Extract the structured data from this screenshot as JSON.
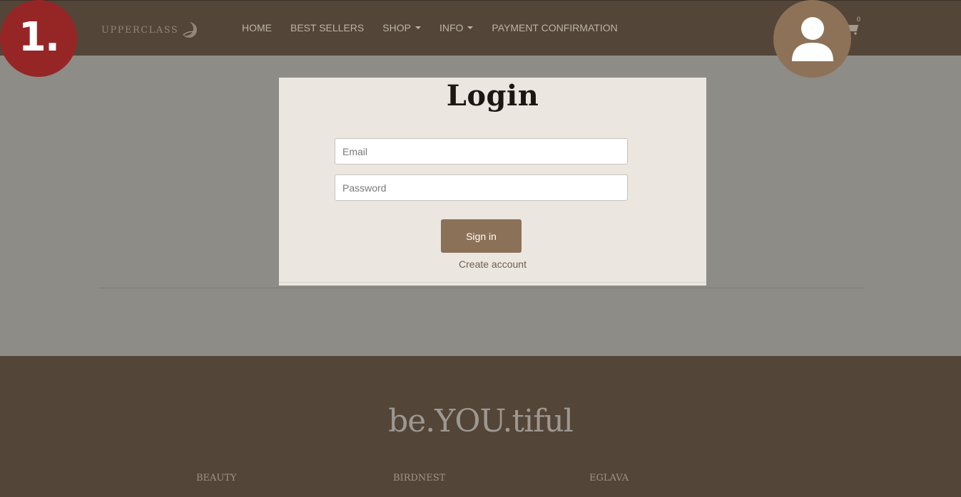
{
  "header": {
    "logo_text": "UPPERCLASS",
    "nav": [
      {
        "label": "HOME",
        "dropdown": false
      },
      {
        "label": "BEST SELLERS",
        "dropdown": false
      },
      {
        "label": "SHOP",
        "dropdown": true
      },
      {
        "label": "INFO",
        "dropdown": true
      },
      {
        "label": "PAYMENT CONFIRMATION",
        "dropdown": false
      }
    ],
    "cart_icon": "cart-icon",
    "cart_count": "0"
  },
  "overlay": {
    "step_label": "1.",
    "step_color": "#962626",
    "avatar_icon": "user-icon",
    "avatar_color": "#8d7257"
  },
  "login": {
    "title": "Login",
    "email_placeholder": "Email",
    "password_placeholder": "Password",
    "signin_label": "Sign in",
    "create_account_label": "Create account"
  },
  "footer": {
    "tagline": "be.YOU.tiful",
    "columns": [
      "BEAUTY",
      "BIRDNEST",
      "EGLAVA"
    ]
  },
  "colors": {
    "brand_brown": "#534537",
    "accent_button": "#8b7158",
    "page_bg": "#8d8c86",
    "card_bg": "#ebe6e0"
  }
}
